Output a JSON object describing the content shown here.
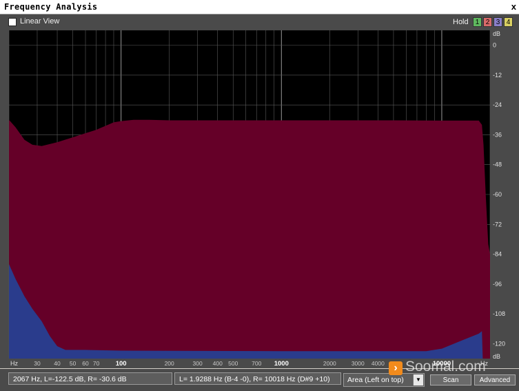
{
  "window": {
    "title": "Frequency Analysis",
    "close_label": "x"
  },
  "toolbar": {
    "linear_view_label": "Linear View",
    "linear_view_checked": false,
    "hold_label": "Hold",
    "hold_buttons": [
      {
        "label": "1",
        "color": "#5fb85f"
      },
      {
        "label": "2",
        "color": "#d96a6a"
      },
      {
        "label": "3",
        "color": "#8a7fc9"
      },
      {
        "label": "4",
        "color": "#d8cf62"
      }
    ]
  },
  "chart_data": {
    "type": "area",
    "xscale": "log",
    "xlim": [
      20,
      20000
    ],
    "ylim": [
      -126,
      6
    ],
    "x_unit": "Hz",
    "y_unit": "dB",
    "x_ticks": [
      {
        "v": 30,
        "label": "30"
      },
      {
        "v": 40,
        "label": "40"
      },
      {
        "v": 50,
        "label": "50"
      },
      {
        "v": 60,
        "label": "60"
      },
      {
        "v": 70,
        "label": "70"
      },
      {
        "v": 100,
        "label": "100"
      },
      {
        "v": 200,
        "label": "200"
      },
      {
        "v": 300,
        "label": "300"
      },
      {
        "v": 400,
        "label": "400"
      },
      {
        "v": 500,
        "label": "500"
      },
      {
        "v": 700,
        "label": "700"
      },
      {
        "v": 1000,
        "label": "1000"
      },
      {
        "v": 2000,
        "label": "2000"
      },
      {
        "v": 3000,
        "label": "3000"
      },
      {
        "v": 4000,
        "label": "4000"
      },
      {
        "v": 10000,
        "label": "10000"
      }
    ],
    "major_x": [
      100,
      1000,
      10000
    ],
    "y_ticks": [
      0,
      -12,
      -24,
      -36,
      -48,
      -60,
      -72,
      -84,
      -96,
      -108,
      -120
    ],
    "colors": {
      "background": "#000000",
      "right": "#650028",
      "left": "#2a3c8c",
      "grid": "#5a5a5a"
    },
    "series": [
      {
        "key": "right",
        "points": [
          [
            20,
            -30
          ],
          [
            22,
            -33
          ],
          [
            25,
            -38
          ],
          [
            28,
            -40
          ],
          [
            32,
            -40.5
          ],
          [
            40,
            -39
          ],
          [
            50,
            -37
          ],
          [
            70,
            -34
          ],
          [
            90,
            -31
          ],
          [
            100,
            -30.5
          ],
          [
            120,
            -30
          ],
          [
            150,
            -30
          ],
          [
            200,
            -30.2
          ],
          [
            1000,
            -30.2
          ],
          [
            5000,
            -30.2
          ],
          [
            10000,
            -30.3
          ],
          [
            17000,
            -30.3
          ],
          [
            17800,
            -32
          ],
          [
            18200,
            -40
          ],
          [
            18800,
            -60
          ],
          [
            19500,
            -80
          ],
          [
            20000,
            -84
          ]
        ]
      },
      {
        "key": "left",
        "points": [
          [
            20,
            -88
          ],
          [
            22,
            -94
          ],
          [
            25,
            -101
          ],
          [
            28,
            -106
          ],
          [
            32,
            -111
          ],
          [
            36,
            -117
          ],
          [
            40,
            -121
          ],
          [
            45,
            -122.5
          ],
          [
            60,
            -122.5
          ],
          [
            100,
            -122.8
          ],
          [
            1000,
            -123
          ],
          [
            8000,
            -123
          ],
          [
            10000,
            -122
          ],
          [
            13000,
            -119
          ],
          [
            17000,
            -116
          ],
          [
            17800,
            -115
          ],
          [
            18000,
            -126
          ]
        ]
      }
    ]
  },
  "status": {
    "cursor": "2067 Hz, L=-122.5 dB, R= -30.6 dB",
    "range": "L= 1.9288 Hz (B-4 -0), R=  10018 Hz (D#9 +10)",
    "view_mode": "Area (Left on top)",
    "scan_label": "Scan",
    "advanced_label": "Advanced"
  },
  "watermark": "Soomal.com"
}
